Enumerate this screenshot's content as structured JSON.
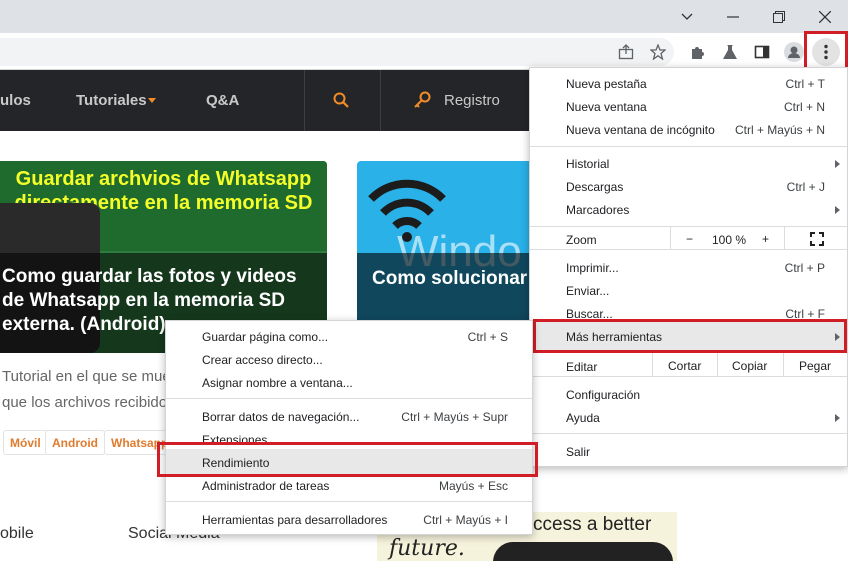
{
  "window": {
    "controls": {
      "minimize_icon": "chevron-down-icon",
      "restore_icon": "restore-icon",
      "close_icon": "close-icon"
    }
  },
  "toolbar": {
    "icons": [
      "share-icon",
      "star-icon",
      "extensions-icon",
      "labs-icon",
      "sidepanel-icon",
      "profile-icon",
      "kebab-menu-icon"
    ]
  },
  "site": {
    "nav": {
      "partial": "ulos",
      "tutoriales": "Tutoriales",
      "qa": "Q&A",
      "registro": "Registro"
    },
    "card1": {
      "banner": "Guardar archvios de Whatsapp directamente en la memoria SD",
      "title": "Como guardar las fotos y videos de Whatsapp en la memoria SD externa. (Android)"
    },
    "card2": {
      "banner_text": "Windo",
      "title": "Como solucionar el error de conexión a Internet"
    },
    "excerpt_line1": "Tutorial en el que se muestra",
    "excerpt_line2": "que los archivos recibidos",
    "tags": [
      "Móvil",
      "Android",
      "Whatsapp"
    ],
    "footer": {
      "left": "obile",
      "social": "Social Media"
    },
    "ad": {
      "text": "ccess a better",
      "script": "future."
    }
  },
  "chrome_menu": {
    "items": {
      "new_tab": {
        "label": "Nueva pestaña",
        "shortcut": "Ctrl + T"
      },
      "new_window": {
        "label": "Nueva ventana",
        "shortcut": "Ctrl + N"
      },
      "incognito": {
        "label": "Nueva ventana de incógnito",
        "shortcut": "Ctrl + Mayús + N"
      },
      "history": {
        "label": "Historial"
      },
      "downloads": {
        "label": "Descargas",
        "shortcut": "Ctrl + J"
      },
      "bookmarks": {
        "label": "Marcadores"
      },
      "zoom": {
        "label": "Zoom",
        "minus": "−",
        "value": "100 %",
        "plus": "+"
      },
      "print": {
        "label": "Imprimir...",
        "shortcut": "Ctrl + P"
      },
      "cast": {
        "label": "Enviar..."
      },
      "find": {
        "label": "Buscar...",
        "shortcut": "Ctrl + F"
      },
      "more_tools": {
        "label": "Más herramientas"
      },
      "edit": {
        "label": "Editar",
        "cut": "Cortar",
        "copy": "Copiar",
        "paste": "Pegar"
      },
      "settings": {
        "label": "Configuración"
      },
      "help": {
        "label": "Ayuda"
      },
      "exit": {
        "label": "Salir"
      }
    }
  },
  "submenu": {
    "items": {
      "save_page": {
        "label": "Guardar página como...",
        "shortcut": "Ctrl + S"
      },
      "create_shortcut": {
        "label": "Crear acceso directo..."
      },
      "name_window": {
        "label": "Asignar nombre a ventana..."
      },
      "clear_data": {
        "label": "Borrar datos de navegación...",
        "shortcut": "Ctrl + Mayús + Supr"
      },
      "extensions": {
        "label": "Extensiones"
      },
      "performance": {
        "label": "Rendimiento"
      },
      "task_manager": {
        "label": "Administrador de tareas",
        "shortcut": "Mayús + Esc"
      },
      "dev_tools": {
        "label": "Herramientas para desarrolladores",
        "shortcut": "Ctrl + Mayús + I"
      }
    }
  },
  "colors": {
    "highlight_box": "#d01d26",
    "nav_bg": "#242528",
    "accent_orange": "#f28c28",
    "tag_text": "#e07b2d"
  }
}
